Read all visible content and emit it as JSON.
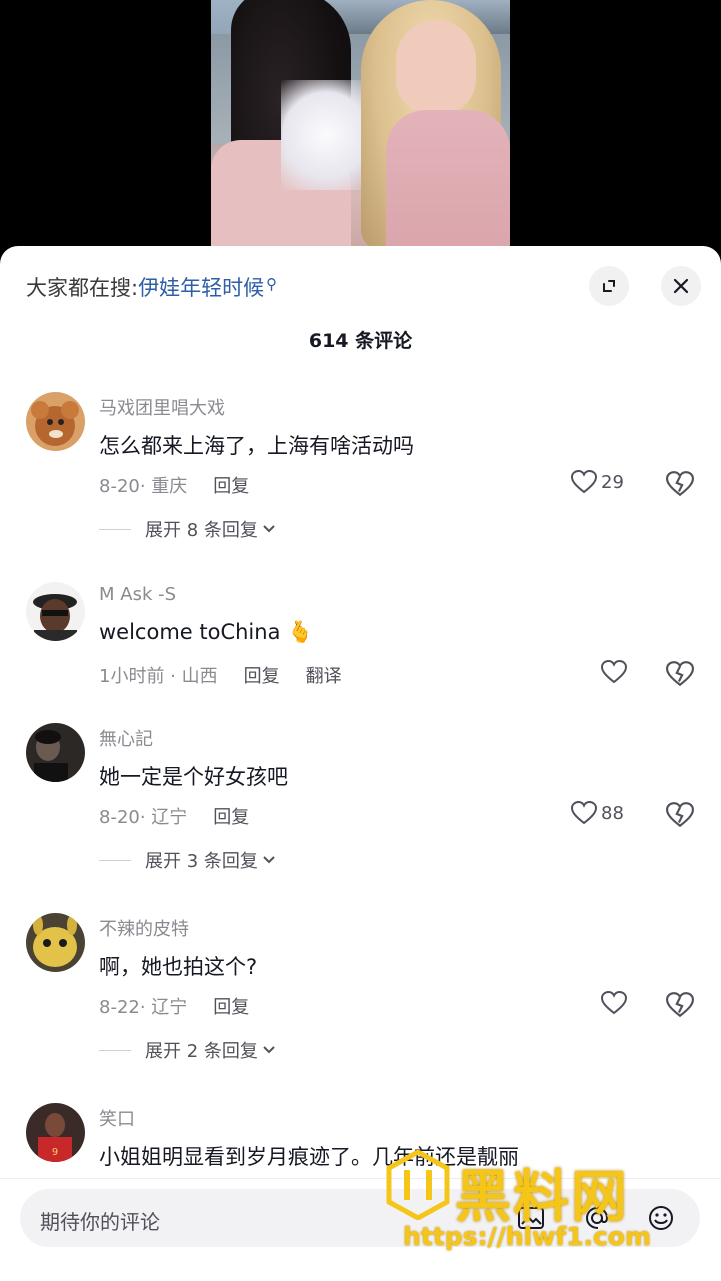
{
  "search_hint": {
    "prefix": "大家都在搜:",
    "term": "伊娃年轻时候"
  },
  "comment_count": "614 条评论",
  "comments": [
    {
      "user": "马戏团里唱大戏",
      "text": "怎么都来上海了，上海有啥活动吗",
      "meta": "8-20· 重庆",
      "reply": "回复",
      "likes": "29",
      "expand": "展开 8 条回复"
    },
    {
      "user": "M Ask -S",
      "text": "welcome toChina",
      "emoji": "🫰",
      "meta": "1小时前 · 山西",
      "reply": "回复",
      "translate": "翻译",
      "likes": ""
    },
    {
      "user": "無心記",
      "text": "她一定是个好女孩吧",
      "meta": "8-20· 辽宁",
      "reply": "回复",
      "likes": "88",
      "expand": "展开 3 条回复"
    },
    {
      "user": "不辣的皮特",
      "text": "啊，她也拍这个?",
      "meta": "8-22· 辽宁",
      "reply": "回复",
      "likes": "",
      "expand": "展开 2 条回复"
    },
    {
      "user": "笑口",
      "text": "小姐姐明显看到岁月痕迹了。几年前还是靓丽"
    }
  ],
  "input": {
    "placeholder": "期待你的评论"
  },
  "watermark": {
    "title": "黑料网",
    "url": "https://hlwf1.com"
  },
  "icons": {
    "expand": "expand-icon",
    "close": "close-icon",
    "like": "heart-outline-icon",
    "dislike": "broken-heart-icon",
    "image": "image-icon",
    "mention": "at-icon",
    "emoji": "emoji-icon"
  },
  "colors": {
    "link": "#2e5ea8",
    "muted": "#8a8b91",
    "text": "#161823"
  }
}
